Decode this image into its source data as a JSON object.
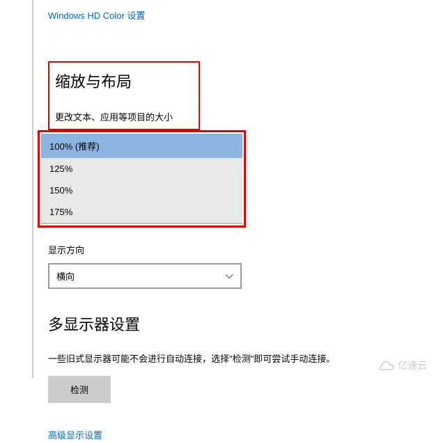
{
  "hdColorLink": "Windows HD Color 设置",
  "scaling": {
    "sectionTitle": "缩放与布局",
    "sizeLabel": "更改文本、应用等项目的大小",
    "options": [
      "100% (推荐)",
      "125%",
      "150%",
      "175%"
    ],
    "selectedIndex": 0
  },
  "orientation": {
    "label": "显示方向",
    "value": "横向"
  },
  "multiMonitor": {
    "sectionTitle": "多显示器设置",
    "description": "一些旧式显示器可能不会进行自动连接，选择\"检测\"即可尝试手动连接。",
    "detectButton": "检测"
  },
  "advancedLink": "高级显示设置",
  "watermark": "亿速云"
}
